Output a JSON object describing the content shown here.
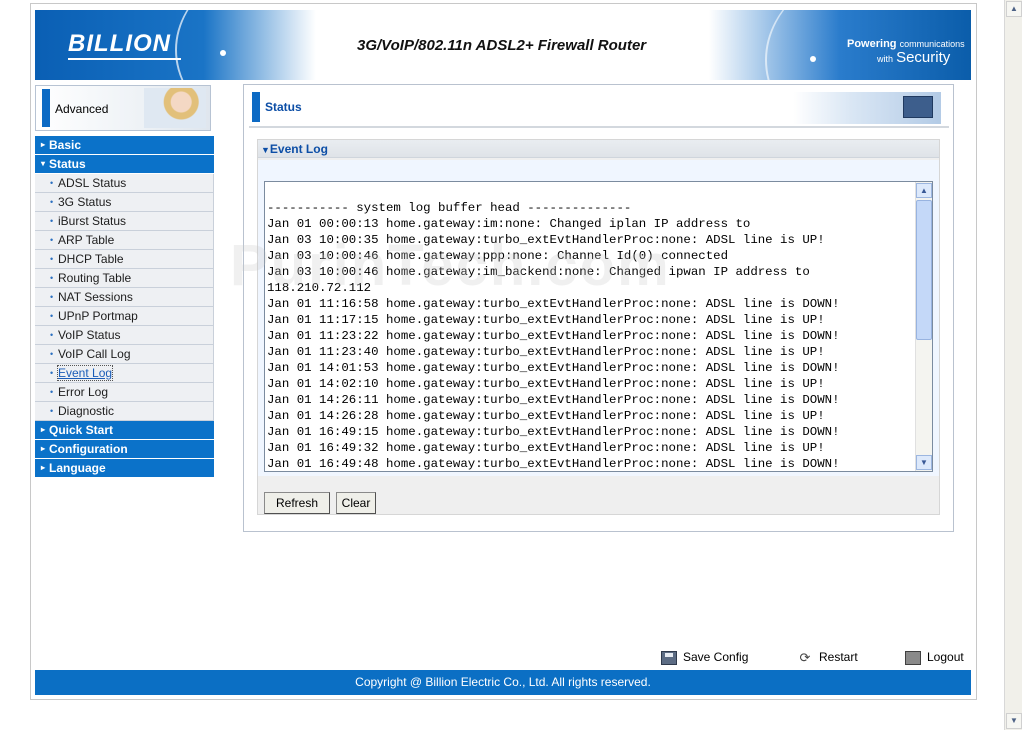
{
  "header": {
    "logo": "BILLION",
    "title": "3G/VoIP/802.11n ADSL2+ Firewall Router",
    "tagline_line1": "Powering",
    "tagline_line1_small": "communications",
    "tagline_line2_small": "with",
    "tagline_line2": "Security"
  },
  "mode": {
    "label": "Advanced"
  },
  "nav": {
    "basic": "Basic",
    "status": "Status",
    "status_items": [
      "ADSL Status",
      "3G Status",
      "iBurst Status",
      "ARP Table",
      "DHCP Table",
      "Routing Table",
      "NAT Sessions",
      "UPnP Portmap",
      "VoIP Status",
      "VoIP Call Log",
      "Event Log",
      "Error Log",
      "Diagnostic"
    ],
    "quick_start": "Quick Start",
    "configuration": "Configuration",
    "language": "Language"
  },
  "main": {
    "title": "Status",
    "section_title": "Event Log",
    "log_lines": [
      "----------- system log buffer head --------------",
      "Jan 01 00:00:13 home.gateway:im:none: Changed iplan IP address to",
      "Jan 03 10:00:35 home.gateway:turbo_extEvtHandlerProc:none: ADSL line is UP!",
      "Jan 03 10:00:46 home.gateway:ppp:none: Channel Id(0) connected",
      "Jan 03 10:00:46 home.gateway:im_backend:none: Changed ipwan IP address to",
      "118.210.72.112",
      "Jan 01 11:16:58 home.gateway:turbo_extEvtHandlerProc:none: ADSL line is DOWN!",
      "Jan 01 11:17:15 home.gateway:turbo_extEvtHandlerProc:none: ADSL line is UP!",
      "Jan 01 11:23:22 home.gateway:turbo_extEvtHandlerProc:none: ADSL line is DOWN!",
      "Jan 01 11:23:40 home.gateway:turbo_extEvtHandlerProc:none: ADSL line is UP!",
      "Jan 01 14:01:53 home.gateway:turbo_extEvtHandlerProc:none: ADSL line is DOWN!",
      "Jan 01 14:02:10 home.gateway:turbo_extEvtHandlerProc:none: ADSL line is UP!",
      "Jan 01 14:26:11 home.gateway:turbo_extEvtHandlerProc:none: ADSL line is DOWN!",
      "Jan 01 14:26:28 home.gateway:turbo_extEvtHandlerProc:none: ADSL line is UP!",
      "Jan 01 16:49:15 home.gateway:turbo_extEvtHandlerProc:none: ADSL line is DOWN!",
      "Jan 01 16:49:32 home.gateway:turbo_extEvtHandlerProc:none: ADSL line is UP!",
      "Jan 01 16:49:48 home.gateway:turbo_extEvtHandlerProc:none: ADSL line is DOWN!"
    ],
    "refresh_label": "Refresh",
    "clear_label": "Clear"
  },
  "actions": {
    "save_config": "Save Config",
    "restart": "Restart",
    "logout": "Logout"
  },
  "footer": {
    "copyright": "Copyright @ Billion Electric Co., Ltd. All rights reserved."
  },
  "watermark": "PurinTech.com",
  "colors": {
    "brand_blue": "#0b72c9",
    "title_blue": "#0c4ea6"
  }
}
